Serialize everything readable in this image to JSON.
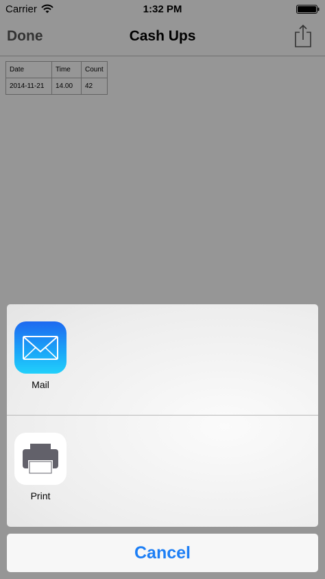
{
  "status_bar": {
    "carrier": "Carrier",
    "time": "1:32 PM"
  },
  "nav": {
    "done_label": "Done",
    "title": "Cash Ups",
    "share_icon": "share-icon"
  },
  "table": {
    "headers": [
      "Date",
      "Time",
      "Count"
    ],
    "rows": [
      [
        "2014-11-21",
        "14.00",
        "42"
      ]
    ]
  },
  "share_sheet": {
    "apps": [
      {
        "label": "Mail",
        "icon": "mail-icon"
      },
      {
        "label": "Print",
        "icon": "printer-icon"
      }
    ],
    "cancel_label": "Cancel"
  },
  "colors": {
    "accent": "#1c7ef5",
    "dim": "rgba(0,0,0,0.40)"
  }
}
